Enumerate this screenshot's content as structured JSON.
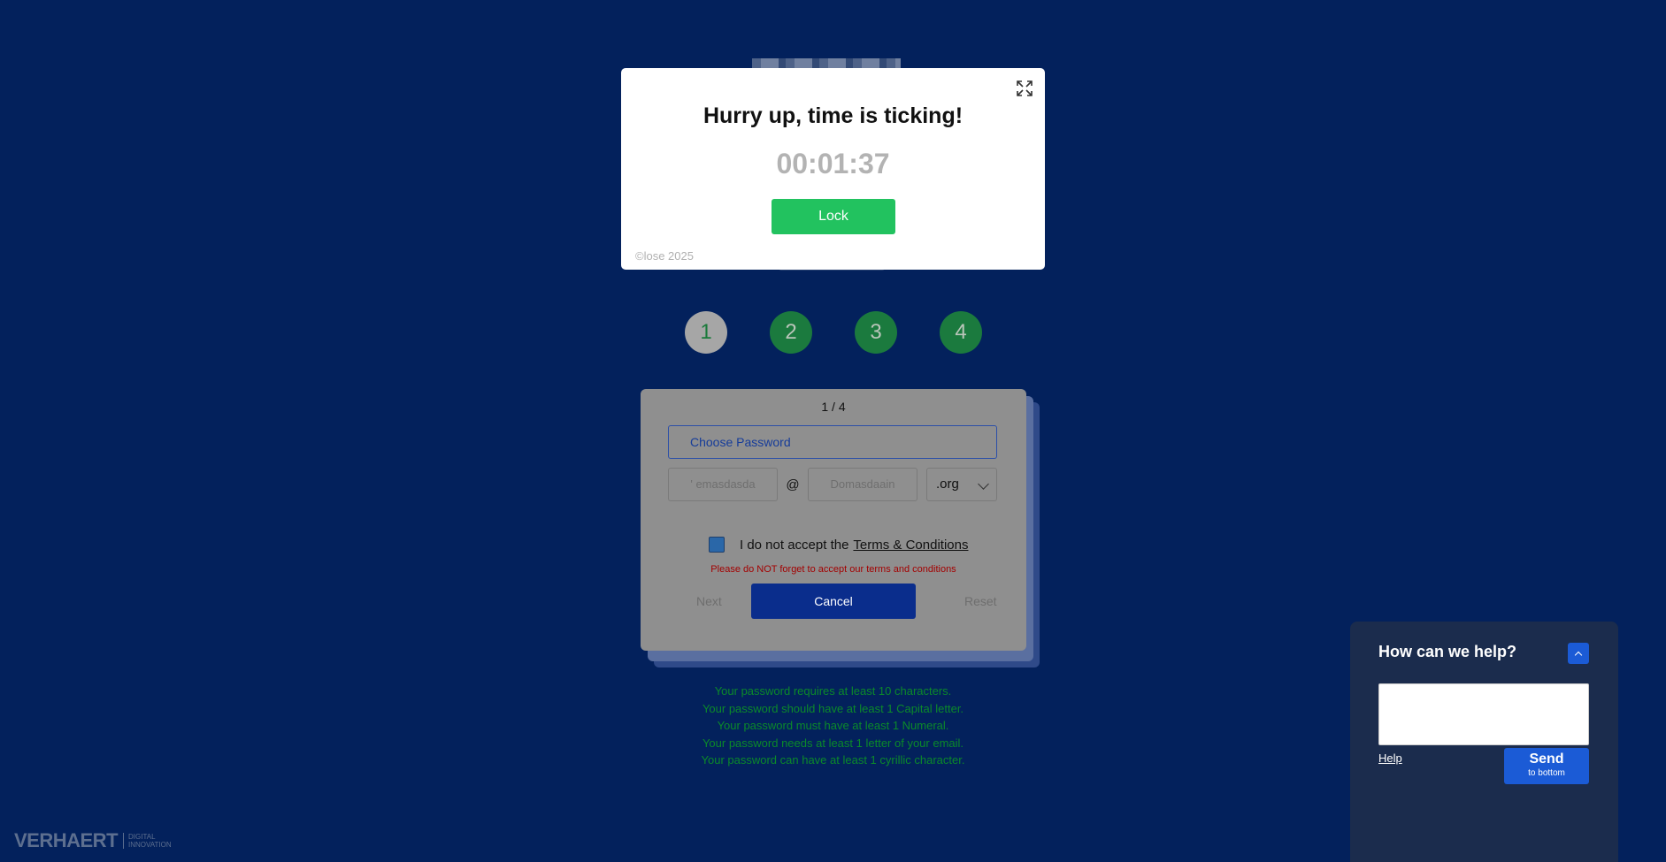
{
  "steps": [
    "1",
    "2",
    "3",
    "4"
  ],
  "card": {
    "pager": "1 / 4",
    "password_placeholder": "Choose Password",
    "email_name": "' emasdasda",
    "at_symbol": "@",
    "domain": "Domasdaain",
    "tld": ".org",
    "terms_prefix": "I do not accept the",
    "terms_link": "Terms & Conditions",
    "warning": "Please do NOT forget to accept our terms and conditions",
    "next": "Next",
    "cancel": "Cancel",
    "reset": "Reset"
  },
  "rules": [
    "Your password requires at least 10 characters.",
    "Your password should have at least 1 Capital letter.",
    "Your password must have at least 1 Numeral.",
    "Your password needs at least 1 letter of your email.",
    "Your password can have at least 1 cyrillic character."
  ],
  "modal": {
    "title": "Hurry up, time is ticking!",
    "timer": "00:01:37",
    "lock": "Lock",
    "copyright": "©lose 2025"
  },
  "logo": {
    "main": "VERHAERT",
    "sub1": "DIGITAL",
    "sub2": "INNOVATION"
  },
  "help": {
    "title": "How can we help?",
    "link": "Help",
    "send": "Send",
    "send_sub": "to bottom"
  },
  "colors": {
    "background": "#03215c",
    "lock": "#22c25f",
    "cancel": "#0a2d8c",
    "step": "#1b7a3e"
  }
}
